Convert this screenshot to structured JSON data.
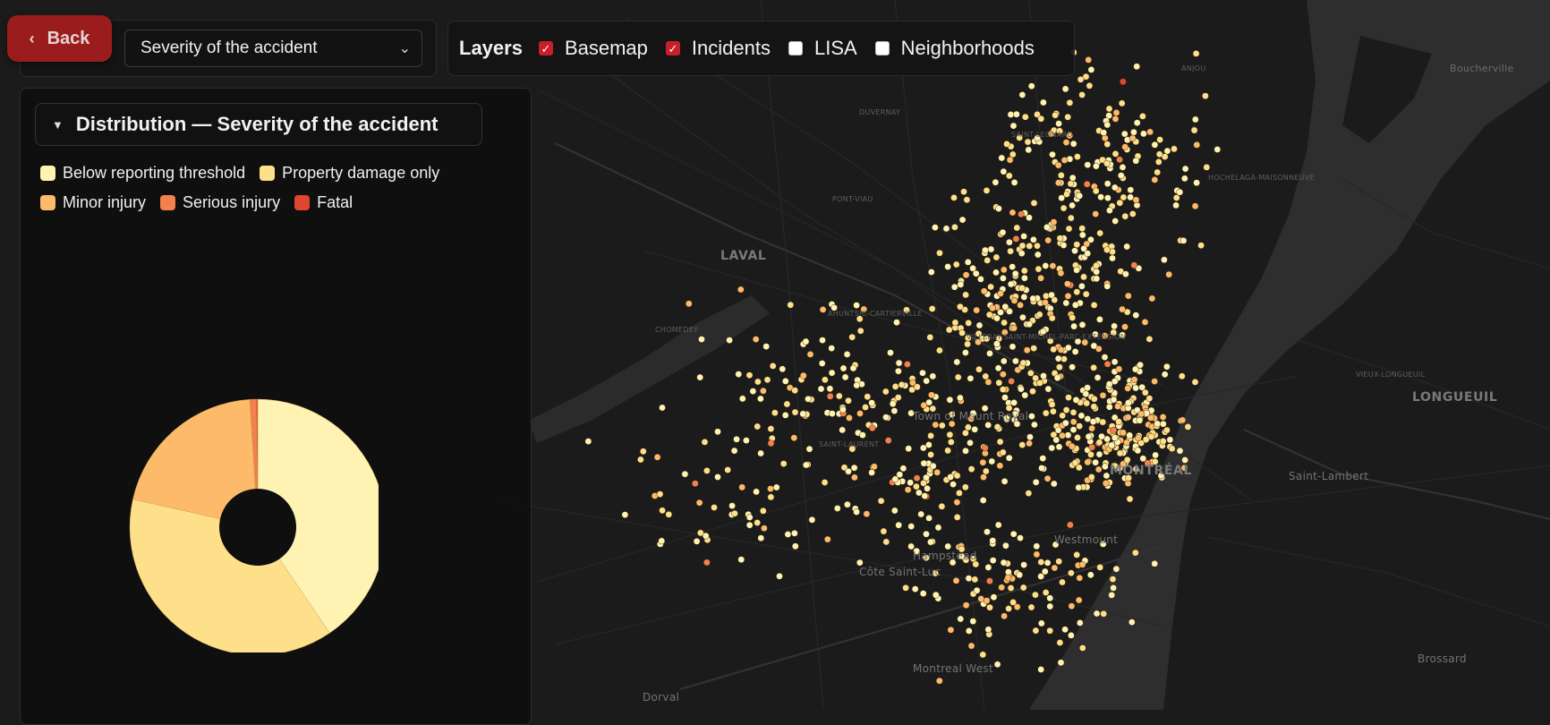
{
  "back": {
    "label": "Back",
    "icon": "chevron-left-icon"
  },
  "select": {
    "value": "Severity of the accident",
    "options": [
      "Severity of the accident"
    ]
  },
  "layers": {
    "title": "Layers",
    "items": [
      {
        "label": "Basemap",
        "checked": true
      },
      {
        "label": "Incidents",
        "checked": true
      },
      {
        "label": "LISA",
        "checked": false
      },
      {
        "label": "Neighborhoods",
        "checked": false
      }
    ]
  },
  "distribution": {
    "title": "Distribution — Severity of the accident",
    "legend": [
      {
        "label": "Below reporting threshold",
        "color": "#fff3b3"
      },
      {
        "label": "Property damage only",
        "color": "#fee08b"
      },
      {
        "label": "Minor injury",
        "color": "#fdba6b"
      },
      {
        "label": "Serious injury",
        "color": "#f4804f"
      },
      {
        "label": "Fatal",
        "color": "#e0462f"
      }
    ]
  },
  "chart_data": {
    "type": "pie",
    "categories": [
      "Below reporting threshold",
      "Property damage only",
      "Minor injury",
      "Serious injury",
      "Fatal"
    ],
    "values": [
      40.5,
      38.0,
      20.5,
      0.8,
      0.2
    ],
    "colors": [
      "#fff3b3",
      "#fee08b",
      "#fdba6b",
      "#f4804f",
      "#e0462f"
    ],
    "donut": true,
    "legend": "top"
  },
  "map": {
    "labels": [
      "Boucherville",
      "LAVAL",
      "CHOMEDEY",
      "DUVERNAY",
      "PONT-VIAU",
      "AHUNTSIC-CARTIERVILLE",
      "SAINT-LEONARD",
      "ANJOU",
      "HOCHELAGA-MAISONNEUVE",
      "VILLERAY-SAINT-MICHEL-PARC-EXTENSION",
      "Town of Mount Royal",
      "Hampstead",
      "Côte Saint-Luc",
      "Westmount",
      "MONTRÉAL",
      "Montreal West",
      "Dorval",
      "LONGUEUIL",
      "VIEUX-LONGUEUIL",
      "Saint-Lambert",
      "Brossard",
      "SAINT-LAURENT"
    ]
  }
}
